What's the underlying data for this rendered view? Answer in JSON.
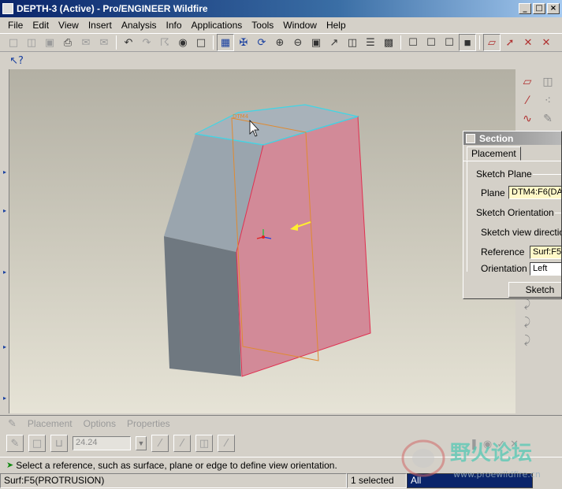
{
  "window": {
    "title": "DEPTH-3 (Active) - Pro/ENGINEER Wildfire",
    "minimize_glyph": "_",
    "maximize_glyph": "□",
    "close_glyph": "×"
  },
  "menu": [
    {
      "label": "File",
      "key": "F"
    },
    {
      "label": "Edit",
      "key": "E"
    },
    {
      "label": "View",
      "key": "V"
    },
    {
      "label": "Insert",
      "key": "I"
    },
    {
      "label": "Analysis",
      "key": "A"
    },
    {
      "label": "Info",
      "key": "n"
    },
    {
      "label": "Applications",
      "key": "p"
    },
    {
      "label": "Tools",
      "key": "T"
    },
    {
      "label": "Window",
      "key": "W"
    },
    {
      "label": "Help",
      "key": "H"
    }
  ],
  "section_dialog": {
    "title": "Section",
    "tab": "Placement",
    "sketch_plane_label": "Sketch Plane",
    "plane_label": "Plane",
    "plane_value": "DTM4:F6(DA",
    "orientation_header": "Sketch Orientation",
    "view_direction_label": "Sketch view directio",
    "reference_label": "Reference",
    "reference_value": "Surf:F5",
    "orientation_label": "Orientation",
    "orientation_value": "Left",
    "sketch_button": "Sketch"
  },
  "dashboard": {
    "tabs": [
      "Placement",
      "Options",
      "Properties"
    ],
    "depth_value": "24.24"
  },
  "message": "Select a reference, such as surface, plane or edge to define view orientation.",
  "status": {
    "selection_info": "Surf:F5(PROTRUSION)",
    "selected_count": "1 selected",
    "filter_value": "All"
  },
  "watermark": {
    "text_cn": "野火论坛",
    "url": "www.proewildfire.cn"
  },
  "colors": {
    "model_gray": "#8e9aa4",
    "model_gray_dark": "#6f7880",
    "surface_pink": "#d28a98",
    "edge_cyan": "#3fd6e6",
    "sketch_orange": "#e08a30"
  }
}
